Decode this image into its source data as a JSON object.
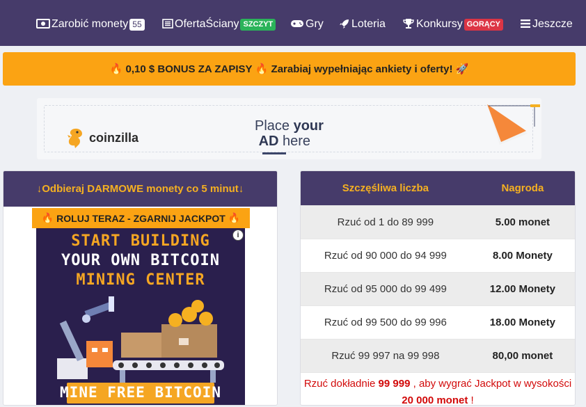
{
  "nav": {
    "items": [
      {
        "label": "Zarobić monety",
        "badge": "55",
        "icon": "money-icon"
      },
      {
        "label": "OfertaŚciany",
        "badge": "SZCZYT",
        "icon": "list-icon"
      },
      {
        "label": "Gry",
        "icon": "gamepad-icon"
      },
      {
        "label": "Loteria",
        "icon": "rocket-icon"
      },
      {
        "label": "Konkursy",
        "badge": "GORĄCY",
        "icon": "trophy-icon"
      },
      {
        "label": "Jeszcze",
        "icon": "menu-icon"
      }
    ]
  },
  "promo": {
    "text": "0,10 $ BONUS ZA ZAPISY",
    "text2": "Zarabiaj wypełniając ankiety i oferty!"
  },
  "ad_banner": {
    "logo_text": "coinzilla",
    "place": "Place",
    "your": "your",
    "ad": "AD",
    "here": "here"
  },
  "faucet": {
    "header": "↓Odbieraj DARMOWE monety co 5 minut↓",
    "jackpot_banner": "ROLUJ TERAZ - ZGARNIJ JACKPOT",
    "ad_lines": [
      "START BUILDING",
      "YOUR OWN BITCOIN",
      "MINING CENTER"
    ],
    "ad_cta": "MINE FREE BITCOIN"
  },
  "rewards": {
    "col_number": "Szczęśliwa liczba",
    "col_prize": "Nagroda",
    "rows": [
      {
        "range": "Rzuć od 1 do 89 999",
        "prize": "5.00 monet"
      },
      {
        "range": "Rzuć od 90 000 do 94 999",
        "prize": "8.00 Monety"
      },
      {
        "range": "Rzuć od 95 000 do 99 499",
        "prize": "12.00 Monety"
      },
      {
        "range": "Rzuć od 99 500 do 99 996",
        "prize": "18.00 Monety"
      },
      {
        "range": "Rzuć 99 997 na 99 998",
        "prize": "80,00 monet"
      }
    ],
    "footer_pre": "Rzuć dokładnie",
    "footer_num": "99 999",
    "footer_mid": ", aby wygrać Jackpot w wysokości",
    "footer_amount": "20 000 monet",
    "footer_end": "!"
  },
  "colors": {
    "nav_bg": "#463b6a",
    "accent_orange": "#fba313",
    "header_gold": "#f5b021",
    "jackpot_red": "#d20a0a"
  }
}
